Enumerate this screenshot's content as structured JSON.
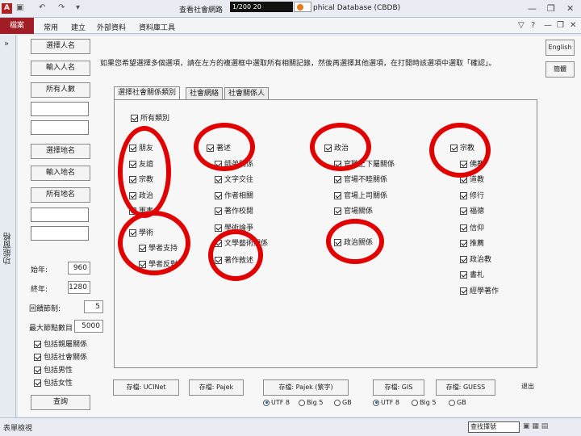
{
  "window": {
    "app_icon": "A",
    "title_left": "查看社會網路",
    "title_input": "1/200 20",
    "title_right": "phical Database (CBDB)",
    "minimize": "—",
    "restore": "❐",
    "close": "✕"
  },
  "ribbon": {
    "tabs": [
      "檔案",
      "常用",
      "建立",
      "外部資料",
      "資料庫工具"
    ],
    "right_icons": [
      "▽",
      "?",
      "—",
      "❐",
      "✕"
    ]
  },
  "nav_pane": {
    "label": "功能窗格",
    "collapse": "»"
  },
  "left_panel": {
    "buttons1": [
      "選擇人名",
      "輸入人名",
      "所有人數"
    ],
    "buttons2": [
      "選擇地名",
      "輸入地名",
      "所有地名"
    ],
    "start_label": "始年:",
    "start_value": "960",
    "end_label": "終年:",
    "end_value": "1280",
    "loop_label": "回饋節制:",
    "loop_value": "5",
    "max_label": "最大節點數目",
    "max_value": "5000",
    "checks": [
      "包括親屬關係",
      "包括社會關係",
      "包括男性",
      "包括女性"
    ],
    "query_button": "查詢"
  },
  "instructions": "如果您希望選擇多個選項，請在左方的複選框中選取所有相關記錄，然後再選擇其他選項，在打開時該選項中選取「確認」。",
  "right_buttons": [
    "English",
    "簡體"
  ],
  "form_tabs": [
    "選擇社會關係類別",
    "社會網絡",
    "社會關係人"
  ],
  "select_all": "所有類別",
  "categories": {
    "col1": {
      "items": [
        "朋友",
        "友誼",
        "宗教",
        "政治",
        "軍事"
      ]
    },
    "col1b": {
      "head": "學術",
      "items": [
        "學者支持",
        "學者反對"
      ]
    },
    "col2": {
      "head": "著述",
      "items": [
        "師弟關係",
        "文字交往",
        "作者相關",
        "著作校閱",
        "學術論爭",
        "文學藝術關係",
        "著作敘述"
      ]
    },
    "col3": {
      "head": "政治",
      "items": [
        "官職上下屬關係",
        "官場不睦關係",
        "官場上司關係",
        "官場關係",
        "政治關係"
      ]
    },
    "col4": {
      "head": "宗教",
      "items": [
        "佛教",
        "道教",
        "修行",
        "福德",
        "信仰",
        "推薦",
        "政治教",
        "書札",
        "經學著作"
      ]
    }
  },
  "export": {
    "buttons": [
      "存檔: UCINet",
      "存檔: Pajek",
      "存檔: Pajek (繁字)",
      "存檔: GIS",
      "存檔: GUESS",
      "退出"
    ],
    "group1": [
      "UTF 8",
      "Big 5",
      "GB"
    ],
    "group2": [
      "UTF 8",
      "Big 5",
      "GB"
    ]
  },
  "status": {
    "text": "表單檢視",
    "badge": "查找擇號"
  },
  "colors": {
    "accent": "#a01d26",
    "highlight_circle": "#e10000"
  }
}
